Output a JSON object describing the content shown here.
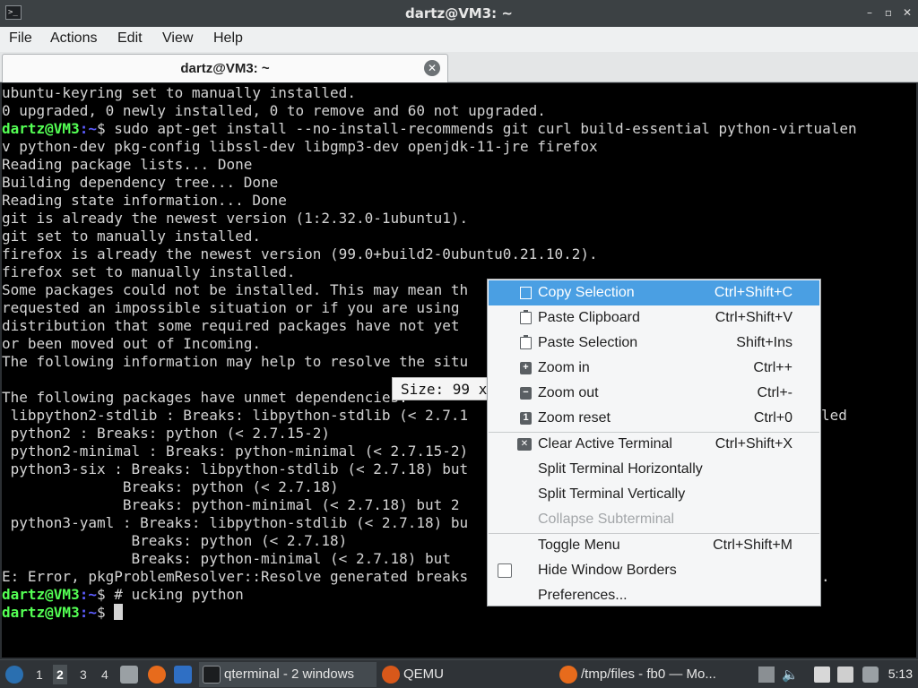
{
  "window": {
    "title": "dartz@VM3: ~",
    "buttons": {
      "minimize": "–",
      "maximize": "▫",
      "close": "✕"
    }
  },
  "menubar": [
    "File",
    "Actions",
    "Edit",
    "View",
    "Help"
  ],
  "tab": {
    "label": "dartz@VM3: ~",
    "close": "✕"
  },
  "terminal": {
    "user": "dartz@VM3",
    "path": ":~",
    "lines": [
      "ubuntu-keyring set to manually installed.",
      "0 upgraded, 0 newly installed, 0 to remove and 60 not upgraded.",
      "",
      "v python-dev pkg-config libssl-dev libgmp3-dev openjdk-11-jre firefox",
      "Reading package lists... Done",
      "Building dependency tree... Done",
      "Reading state information... Done",
      "git is already the newest version (1:2.32.0-1ubuntu1).",
      "git set to manually installed.",
      "firefox is already the newest version (99.0+build2-0ubuntu0.21.10.2).",
      "firefox set to manually installed.",
      "Some packages could not be installed. This may mean th",
      "requested an impossible situation or if you are using",
      "distribution that some required packages have not yet",
      "or been moved out of Incoming.",
      "The following information may help to resolve the situ",
      "",
      "The following packages have unmet dependencies:",
      " libpython2-stdlib : Breaks: libpython-stdlib (< 2.7.1",
      " python2 : Breaks: python (< 2.7.15-2)",
      " python2-minimal : Breaks: python-minimal (< 2.7.15-2)",
      " python3-six : Breaks: libpython-stdlib (< 2.7.18) but",
      "              Breaks: python (< 2.7.18)",
      "              Breaks: python-minimal (< 2.7.18) but 2",
      " python3-yaml : Breaks: libpython-stdlib (< 2.7.18) bu",
      "               Breaks: python (< 2.7.18)",
      "               Breaks: python-minimal (< 2.7.18) but",
      "E: Error, pkgProblemResolver::Resolve generated breaks"
    ],
    "trailing": {
      "line18": "led",
      "line27": "."
    },
    "cmd_install": "$ sudo apt-get install --no-install-recommends git curl build-essential python-virtualen",
    "cmd_comment": "$ # ucking python",
    "cmd_empty": "$ "
  },
  "size_tooltip": "Size: 99 x",
  "context_menu": {
    "items": [
      {
        "label": "Copy Selection",
        "shortcut": "Ctrl+Shift+C",
        "icon": "copy-icon",
        "active": true
      },
      {
        "label": "Paste Clipboard",
        "shortcut": "Ctrl+Shift+V",
        "icon": "paste-icon"
      },
      {
        "label": "Paste Selection",
        "shortcut": "Shift+Ins",
        "icon": "paste-icon"
      },
      {
        "label": "Zoom in",
        "shortcut": "Ctrl++",
        "icon": "zoom-in-icon"
      },
      {
        "label": "Zoom out",
        "shortcut": "Ctrl+-",
        "icon": "zoom-out-icon"
      },
      {
        "label": "Zoom reset",
        "shortcut": "Ctrl+0",
        "icon": "zoom-reset-icon"
      },
      {
        "label": "Clear Active Terminal",
        "shortcut": "Ctrl+Shift+X",
        "icon": "clear-icon"
      },
      {
        "label": "Split Terminal Horizontally",
        "shortcut": ""
      },
      {
        "label": "Split Terminal Vertically",
        "shortcut": ""
      },
      {
        "label": "Collapse Subterminal",
        "shortcut": "",
        "disabled": true
      },
      {
        "label": "Toggle Menu",
        "shortcut": "Ctrl+Shift+M"
      },
      {
        "label": "Hide Window Borders",
        "shortcut": "",
        "checkbox": true,
        "checked": false
      },
      {
        "label": "Preferences...",
        "shortcut": ""
      }
    ]
  },
  "taskbar": {
    "workspaces": [
      "1",
      "2",
      "3",
      "4"
    ],
    "current_workspace": "2",
    "tasks": [
      {
        "label": "qterminal - 2 windows",
        "icon": "terminal-icon",
        "active": true
      },
      {
        "label": "QEMU",
        "icon": "qemu-icon"
      },
      {
        "label": "/tmp/files - fb0 — Mo...",
        "icon": "firefox-icon"
      }
    ],
    "clock": "5:13"
  },
  "colors": {
    "terminal_bg": "#000000",
    "terminal_fg": "#d4d4d4",
    "prompt_user": "#54ff54",
    "prompt_path": "#5c5cff",
    "menu_highlight": "#4a9fe3"
  }
}
